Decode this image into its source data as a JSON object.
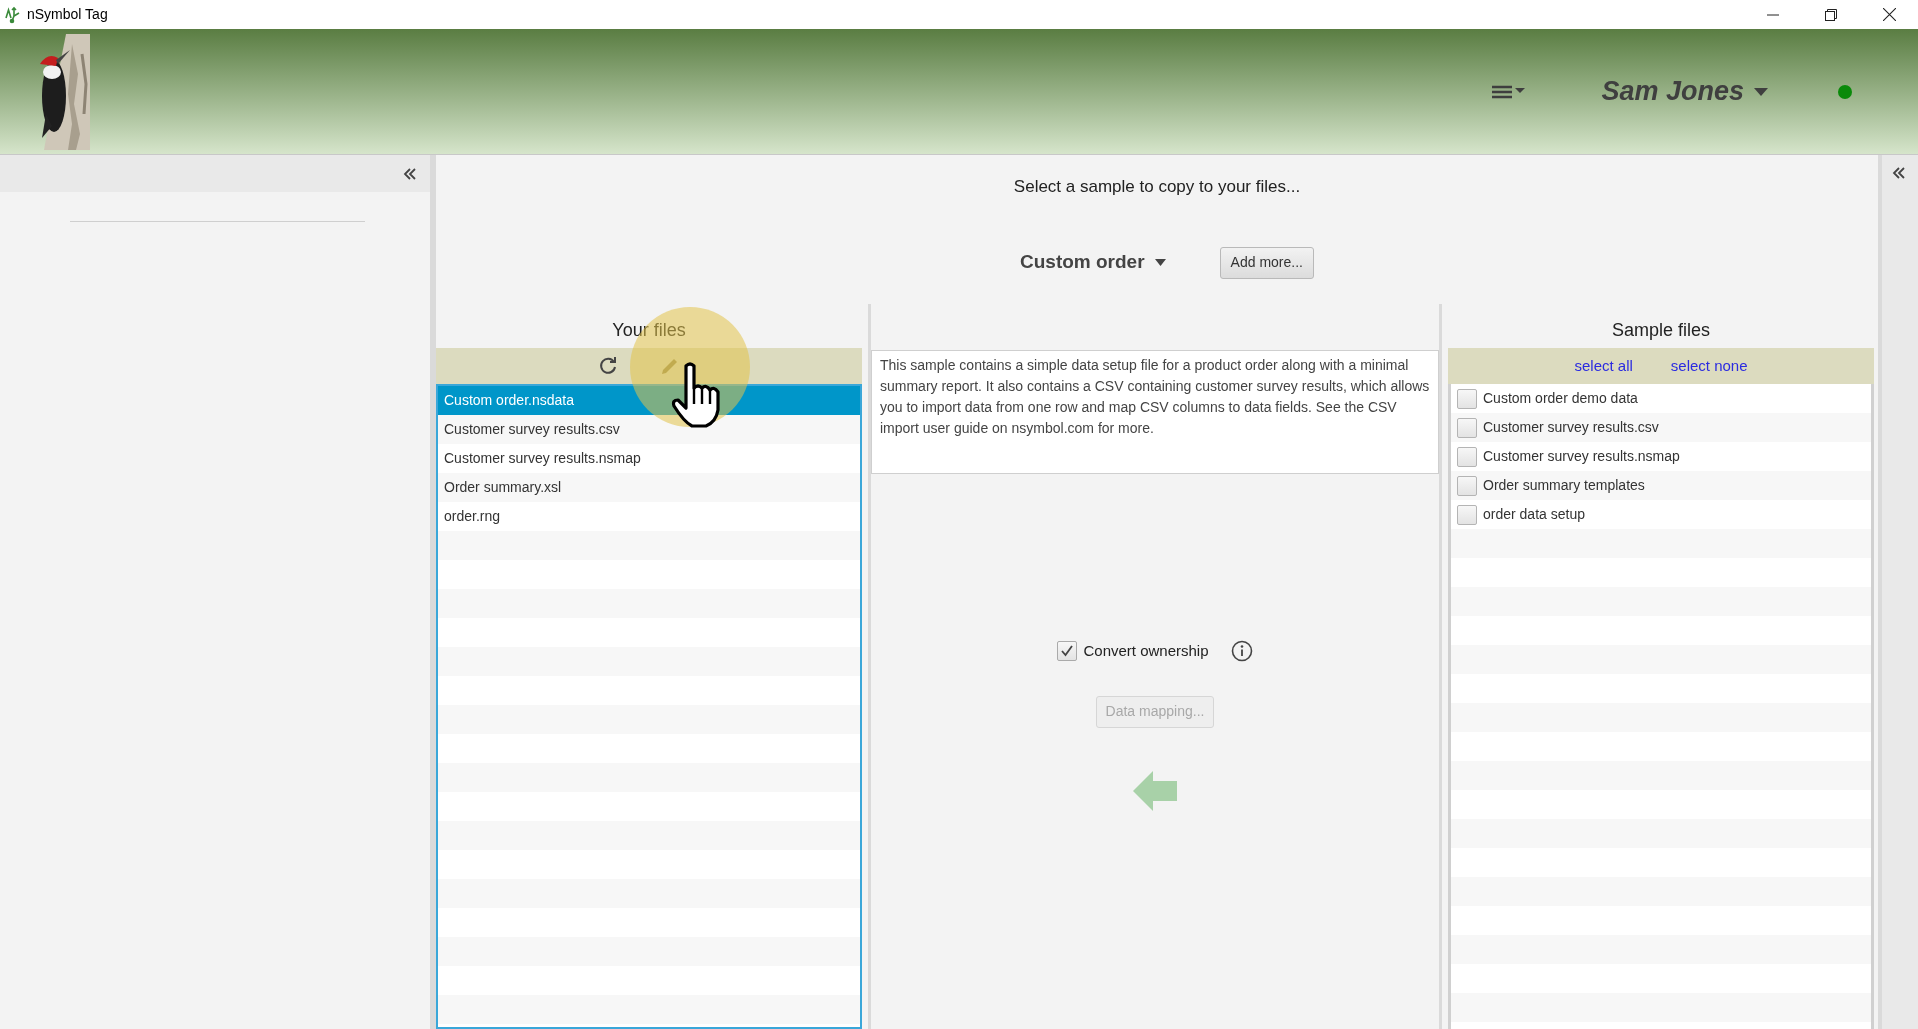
{
  "window": {
    "title": "nSymbol Tag"
  },
  "header": {
    "user": "Sam Jones",
    "online": true
  },
  "main": {
    "prompt": "Select a sample to copy to your files...",
    "sample_dropdown": "Custom order",
    "add_button": "Add more..."
  },
  "your_files": {
    "title": "Your files",
    "items": [
      {
        "name": "Custom order.nsdata",
        "selected": true
      },
      {
        "name": "Customer survey results.csv",
        "selected": false
      },
      {
        "name": "Customer survey results.nsmap",
        "selected": false
      },
      {
        "name": "Order summary.xsl",
        "selected": false
      },
      {
        "name": "order.rng",
        "selected": false
      }
    ]
  },
  "description": "This sample contains a simple data setup file for a product order along with a minimal summary report. It also contains a CSV containing customer survey results, which allows you to import data from one row and map CSV columns to data fields. See the CSV import user guide on nsymbol.com for more.",
  "convert_ownership": {
    "label": "Convert ownership",
    "checked": true
  },
  "data_mapping_button": {
    "label": "Data mapping...",
    "disabled": true
  },
  "sample_files": {
    "title": "Sample files",
    "select_all": "select all",
    "select_none": "select none",
    "items": [
      {
        "name": "Custom order demo data",
        "checked": false
      },
      {
        "name": "Customer survey results.csv",
        "checked": false
      },
      {
        "name": "Customer survey results.nsmap",
        "checked": false
      },
      {
        "name": "Order summary templates",
        "checked": false
      },
      {
        "name": "order data setup",
        "checked": false
      }
    ]
  }
}
